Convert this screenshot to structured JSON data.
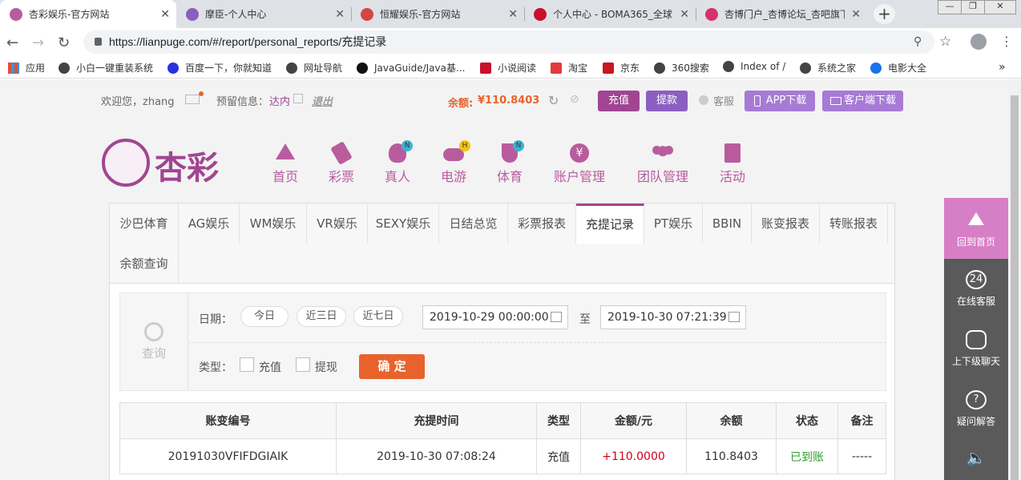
{
  "browser": {
    "tabs": [
      {
        "title": "杏彩娱乐-官方网站",
        "color": "#b85c9e"
      },
      {
        "title": "摩臣-个人中心",
        "color": "#8b5fbf"
      },
      {
        "title": "恒耀娱乐-官方网站",
        "color": "#d64545"
      },
      {
        "title": "个人中心 - BOMA365_全球",
        "color": "#c8102e"
      },
      {
        "title": "杏博门户_杏博论坛_杏吧旗下",
        "color": "#d6336c"
      }
    ],
    "close_glyph": "✕",
    "newtab_glyph": "+",
    "window_controls": [
      "—",
      "❐",
      "✕"
    ],
    "url": "https://lianpuge.com/#/report/personal_reports/充提记录",
    "bookmarks": [
      "应用",
      "小白一键重装系统",
      "百度一下，你就知道",
      "网址导航",
      "JavaGuide/Java基...",
      "小说阅读",
      "淘宝",
      "京东",
      "360搜索",
      "Index of /",
      "系统之家",
      "电影大全"
    ],
    "more_glyph": "»"
  },
  "topbar": {
    "welcome": "欢迎您，zhang",
    "reserved_label": "预留信息：",
    "reserved_value": "达内",
    "logout": "退出",
    "balance_label": "余额: ",
    "balance_value": "¥110.8403",
    "recharge": "充值",
    "withdraw": "提款",
    "service": "客服",
    "app_download": "APP下载",
    "client_download": "客户端下载"
  },
  "logo": {
    "text": "杏彩",
    "color": "#a14592"
  },
  "main_nav": [
    {
      "label": "首页",
      "icon": "home-icon",
      "badge": ""
    },
    {
      "label": "彩票",
      "icon": "ticket-icon",
      "badge": ""
    },
    {
      "label": "真人",
      "icon": "person-icon",
      "badge": "N"
    },
    {
      "label": "电游",
      "icon": "gamepad-icon",
      "badge": "H"
    },
    {
      "label": "体育",
      "icon": "trophy-icon",
      "badge": "N"
    },
    {
      "label": "账户管理",
      "icon": "yen-icon",
      "badge": ""
    },
    {
      "label": "团队管理",
      "icon": "team-icon",
      "badge": ""
    },
    {
      "label": "活动",
      "icon": "gift-icon",
      "badge": ""
    }
  ],
  "report_tabs": [
    "沙巴体育",
    "AG娱乐",
    "WM娱乐",
    "VR娱乐",
    "SEXY娱乐",
    "日结总览",
    "彩票报表",
    "充提记录",
    "PT娱乐",
    "BBIN",
    "账变报表",
    "转账报表",
    "余额查询"
  ],
  "active_tab": "充提记录",
  "query": {
    "label": "查询",
    "date_label": "日期：",
    "today": "今日",
    "last3": "近三日",
    "last7": "近七日",
    "start": "2019-10-29 00:00:00",
    "to": "至",
    "end": "2019-10-30 07:21:39",
    "type_label": "类型：",
    "type_recharge": "充值",
    "type_withdraw": "提现",
    "confirm": "确 定"
  },
  "table": {
    "headers": [
      "账变编号",
      "充提时间",
      "类型",
      "金额/元",
      "余额",
      "状态",
      "备注"
    ],
    "rows": [
      [
        "20191030VFIFDGIAIK",
        "2019-10-30 07:08:24",
        "充值",
        "+110.0000",
        "110.8403",
        "已到账",
        "-----"
      ]
    ]
  },
  "side": {
    "home": "回到首页",
    "online": "在线客服",
    "chat": "上下级聊天",
    "faq": "疑问解答",
    "badge24": "24"
  },
  "colors": {
    "brand": "#a14592",
    "accent_orange": "#e8632b",
    "money_red": "#d0021b",
    "status_green": "#2e9e2e",
    "btn_purple": "#8b5fbf"
  }
}
